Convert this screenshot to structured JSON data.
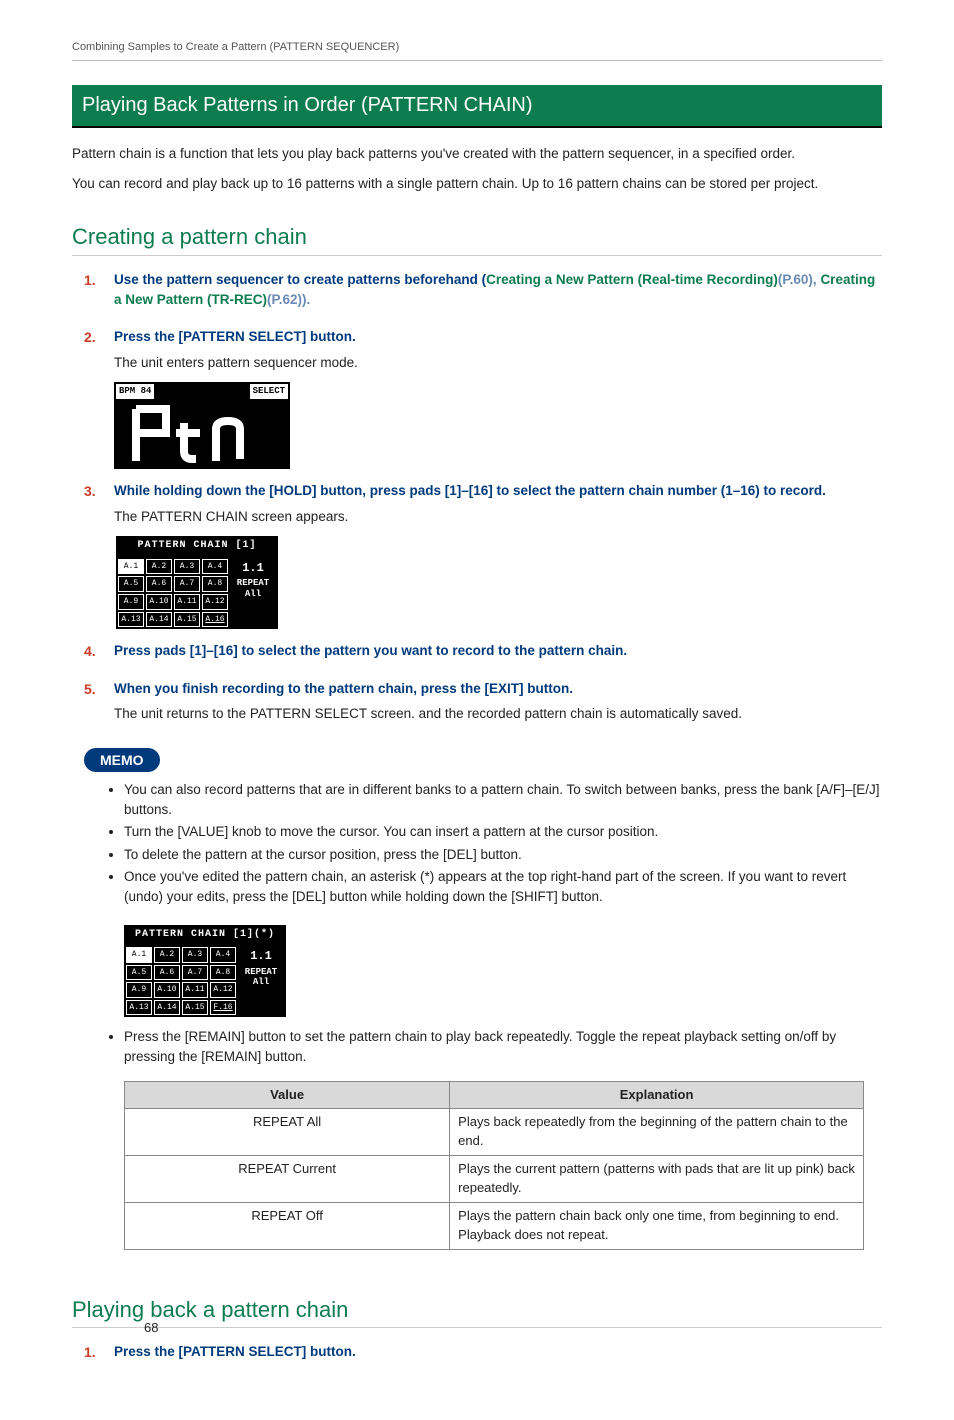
{
  "running_head": "Combining Samples to Create a Pattern (PATTERN SEQUENCER)",
  "banner_title": "Playing Back Patterns in Order (PATTERN CHAIN)",
  "intro_p1": "Pattern chain is a function that lets you play back patterns you've created with the pattern sequencer, in a specified order.",
  "intro_p2": "You can record and play back up to 16 patterns with a single pattern chain. Up to 16 pattern chains can be stored per project.",
  "section1_title": "Creating a pattern chain",
  "steps": {
    "s1": {
      "num": "1.",
      "pre": "Use the pattern sequencer to create patterns beforehand (",
      "link1": "Creating a New Pattern (Real-time Recording)",
      "mid1": "(P.60), ",
      "link2": "Creating a New Pattern (TR-REC)",
      "post": "(P.62)).",
      "note": ""
    },
    "s2": {
      "num": "2.",
      "inst": "Press the [PATTERN SELECT] button.",
      "note": "The unit enters pattern sequencer mode."
    },
    "s3": {
      "num": "3.",
      "inst": "While holding down the [HOLD] button, press pads [1]–[16] to select the pattern chain number (1–16) to record.",
      "note": "The PATTERN CHAIN screen appears."
    },
    "s4": {
      "num": "4.",
      "inst": "Press pads [1]–[16] to select the pattern you want to record to the pattern chain."
    },
    "s5": {
      "num": "5.",
      "inst": "When you finish recording to the pattern chain, press the [EXIT] button.",
      "note": "The unit returns to the PATTERN SELECT screen. and the recorded pattern chain is automatically saved."
    }
  },
  "lcd1": {
    "bpm": "BPM 84",
    "mode": "SELECT",
    "big": "Ptn"
  },
  "lcd_chain1": {
    "title": "PATTERN CHAIN [1]",
    "step": "1.1",
    "repeat_l1": "REPEAT",
    "repeat_l2": "All",
    "cells": [
      "A.1",
      "A.2",
      "A.3",
      "A.4",
      "A.5",
      "A.6",
      "A.7",
      "A.8",
      "A.9",
      "A.10",
      "A.11",
      "A.12",
      "A.13",
      "A.14",
      "A.15",
      "A.16"
    ]
  },
  "memo_label": "MEMO",
  "memo_items": [
    "You can also record patterns that are in different banks to a pattern chain. To switch between banks, press the bank [A/F]–[E/J] buttons.",
    "Turn the [VALUE] knob to move the cursor. You can insert a pattern at the cursor position.",
    "To delete the pattern at the cursor position, press the [DEL] button.",
    "Once you've edited the pattern chain, an asterisk (*) appears at the top right-hand part of the screen. If you want to revert (undo) your edits, press the [DEL] button while holding down the [SHIFT] button."
  ],
  "lcd_chain2": {
    "title": "PATTERN CHAIN [1](*)",
    "step": "1.1",
    "repeat_l1": "REPEAT",
    "repeat_l2": "All",
    "cells": [
      "A.1",
      "A.2",
      "A.3",
      "A.4",
      "A.5",
      "A.6",
      "A.7",
      "A.8",
      "A.9",
      "A.10",
      "A.11",
      "A.12",
      "A.13",
      "A.14",
      "A.15",
      "F.16"
    ]
  },
  "memo_after": "Press the [REMAIN] button to set the pattern chain to play back repeatedly. Toggle the repeat playback setting on/off by pressing the [REMAIN] button.",
  "table": {
    "head_value": "Value",
    "head_expl": "Explanation",
    "rows": [
      {
        "v": "REPEAT All",
        "e": "Plays back repeatedly from the beginning of the pattern chain to the end."
      },
      {
        "v": "REPEAT Current",
        "e": "Plays the current pattern (patterns with pads that are lit up pink) back repeatedly."
      },
      {
        "v": "REPEAT Off",
        "e": "Plays the pattern chain back only one time, from beginning to end. Playback does not repeat."
      }
    ]
  },
  "section2_title": "Playing back a pattern chain",
  "section2_step1_num": "1.",
  "section2_step1_inst": "Press the [PATTERN SELECT] button.",
  "page_number": "68"
}
